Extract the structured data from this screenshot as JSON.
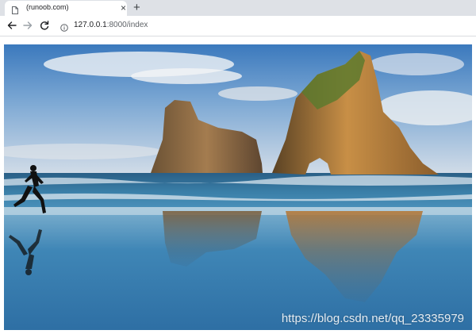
{
  "tab": {
    "title": "(runoob.com)",
    "close_glyph": "×",
    "icon": "document-icon"
  },
  "new_tab_glyph": "+",
  "toolbar": {
    "back_icon": "arrow-left-icon",
    "forward_icon": "arrow-right-icon",
    "reload_icon": "reload-icon",
    "info_icon": "info-icon"
  },
  "address": {
    "host": "127.0.0.1",
    "rest": ":8000/index"
  },
  "image": {
    "description_icon": "landscape-photo",
    "watermark": "https://blog.csdn.net/qq_23335979"
  },
  "colors": {
    "tabstrip": "#dee1e6",
    "sky_top": "#3d7cc0",
    "sky_bottom": "#c9d7e6",
    "sea": "#2f6f9a",
    "rock": "#b07a3e"
  }
}
